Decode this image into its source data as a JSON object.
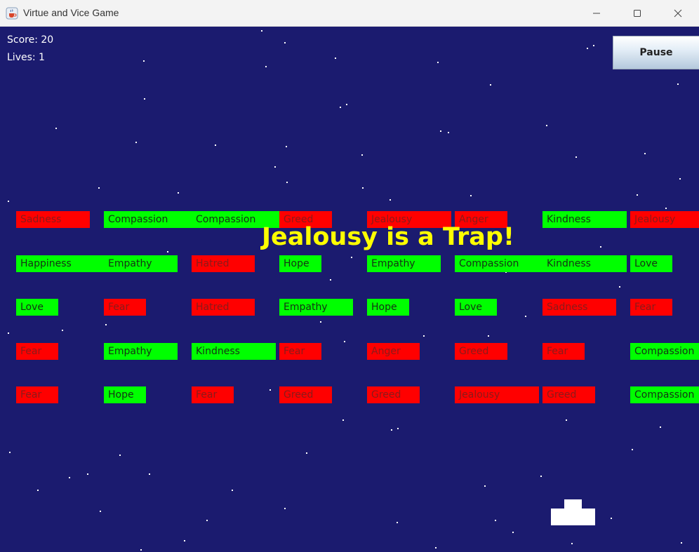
{
  "window": {
    "title": "Virtue and Vice Game",
    "minimize_glyph": "—",
    "maximize_glyph": "☐",
    "close_glyph": "✕"
  },
  "hud": {
    "score_text": "Score: 20",
    "lives_text": "Lives: 1",
    "pause_label": "Pause"
  },
  "message": "Jealousy is a Trap!",
  "colors": {
    "background": "#1b1b6f",
    "virtue": "#00ff00",
    "vice": "#ff0000",
    "message": "#ffff00",
    "paddle": "#ffffff"
  },
  "icons": {
    "app": "java-coffee-cup-icon",
    "minimize": "minimize-icon",
    "maximize": "maximize-icon",
    "close": "close-icon"
  },
  "bricks": [
    {
      "label": "Sadness",
      "type": "vice"
    },
    {
      "label": "Compassion",
      "type": "virtue"
    },
    {
      "label": "Compassion",
      "type": "virtue"
    },
    {
      "label": "Greed",
      "type": "vice"
    },
    {
      "label": "Jealousy",
      "type": "vice"
    },
    {
      "label": "Anger",
      "type": "vice"
    },
    {
      "label": "Kindness",
      "type": "virtue"
    },
    {
      "label": "Jealousy",
      "type": "vice"
    },
    {
      "label": "Happiness",
      "type": "virtue"
    },
    {
      "label": "Empathy",
      "type": "virtue"
    },
    {
      "label": "Hatred",
      "type": "vice"
    },
    {
      "label": "Hope",
      "type": "virtue"
    },
    {
      "label": "Empathy",
      "type": "virtue"
    },
    {
      "label": "Compassion",
      "type": "virtue"
    },
    {
      "label": "Kindness",
      "type": "virtue"
    },
    {
      "label": "Love",
      "type": "virtue"
    },
    {
      "label": "Love",
      "type": "virtue"
    },
    {
      "label": "Fear",
      "type": "vice"
    },
    {
      "label": "Hatred",
      "type": "vice"
    },
    {
      "label": "Empathy",
      "type": "virtue"
    },
    {
      "label": "Hope",
      "type": "virtue"
    },
    {
      "label": "Love",
      "type": "virtue"
    },
    {
      "label": "Sadness",
      "type": "vice"
    },
    {
      "label": "Fear",
      "type": "vice"
    },
    {
      "label": "Fear",
      "type": "vice"
    },
    {
      "label": "Empathy",
      "type": "virtue"
    },
    {
      "label": "Kindness",
      "type": "virtue"
    },
    {
      "label": "Fear",
      "type": "vice"
    },
    {
      "label": "Anger",
      "type": "vice"
    },
    {
      "label": "Greed",
      "type": "vice"
    },
    {
      "label": "Fear",
      "type": "vice"
    },
    {
      "label": "Compassion",
      "type": "virtue"
    },
    {
      "label": "Fear",
      "type": "vice"
    },
    {
      "label": "Hope",
      "type": "virtue"
    },
    {
      "label": "Fear",
      "type": "vice"
    },
    {
      "label": "Greed",
      "type": "vice"
    },
    {
      "label": "Greed",
      "type": "vice"
    },
    {
      "label": "Jealousy",
      "type": "vice"
    },
    {
      "label": "Greed",
      "type": "vice"
    },
    {
      "label": "Compassion",
      "type": "virtue"
    }
  ]
}
